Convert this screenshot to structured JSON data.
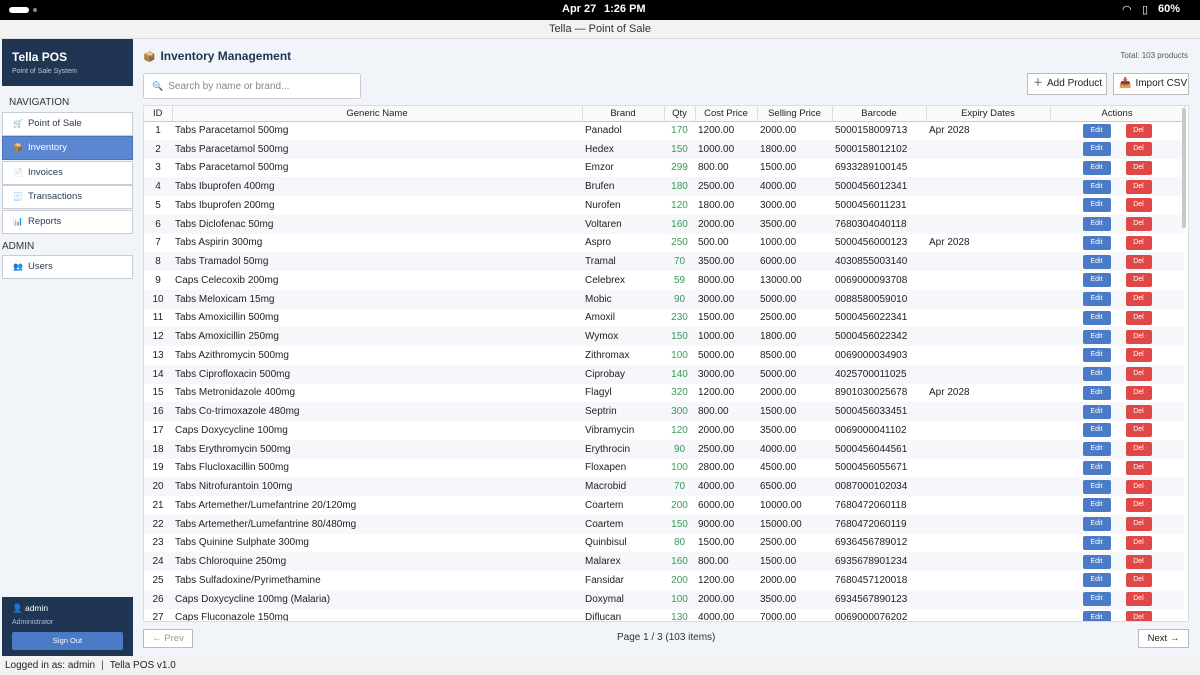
{
  "status_bar": {
    "date": "Apr 27",
    "time": "1:26 PM",
    "battery": "60%",
    "icons": [
      "wifi-icon",
      "do-not-disturb-icon",
      "battery-icon"
    ]
  },
  "window_title": "Tella — Point of Sale",
  "sidebar": {
    "brand_title": "Tella POS",
    "brand_subtitle": "Point of Sale System",
    "nav_header": "NAVIGATION",
    "nav_items": [
      {
        "label": "Point of Sale",
        "icon": "cart-icon",
        "glyph": "🛒"
      },
      {
        "label": "Inventory",
        "icon": "box-icon",
        "glyph": "📦",
        "active": true
      },
      {
        "label": "Invoices",
        "icon": "document-icon",
        "glyph": "📄"
      },
      {
        "label": "Transactions",
        "icon": "receipt-icon",
        "glyph": "🧾"
      },
      {
        "label": "Reports",
        "icon": "chart-icon",
        "glyph": "📊"
      }
    ],
    "admin_header": "ADMIN",
    "admin_items": [
      {
        "label": "Users",
        "icon": "users-icon",
        "glyph": "👥"
      }
    ],
    "user": {
      "name": "admin",
      "role": "Administrator",
      "sign_out": "Sign Out",
      "glyph": "👤"
    }
  },
  "main": {
    "title": "Inventory Management",
    "title_glyph": "📦",
    "total": "Total: 103 products",
    "search_placeholder": "Search by name or brand...",
    "add_product": "Add Product",
    "import_csv": "Import CSV",
    "columns": [
      "ID",
      "Generic Name",
      "Brand",
      "Qty",
      "Cost Price",
      "Selling Price",
      "Barcode",
      "Expiry Dates",
      "Actions"
    ],
    "edit_label": "Edit",
    "delete_label": "Del",
    "rows": [
      [
        "1",
        "Tabs Paracetamol 500mg",
        "Panadol",
        "170",
        "1200.00",
        "2000.00",
        "5000158009713",
        "Apr 2028"
      ],
      [
        "2",
        "Tabs Paracetamol 500mg",
        "Hedex",
        "150",
        "1000.00",
        "1800.00",
        "5000158012102",
        ""
      ],
      [
        "3",
        "Tabs Paracetamol 500mg",
        "Emzor",
        "299",
        "800.00",
        "1500.00",
        "6933289100145",
        ""
      ],
      [
        "4",
        "Tabs Ibuprofen 400mg",
        "Brufen",
        "180",
        "2500.00",
        "4000.00",
        "5000456012341",
        ""
      ],
      [
        "5",
        "Tabs Ibuprofen 200mg",
        "Nurofen",
        "120",
        "1800.00",
        "3000.00",
        "5000456011231",
        ""
      ],
      [
        "6",
        "Tabs Diclofenac 50mg",
        "Voltaren",
        "160",
        "2000.00",
        "3500.00",
        "7680304040118",
        ""
      ],
      [
        "7",
        "Tabs Aspirin 300mg",
        "Aspro",
        "250",
        "500.00",
        "1000.00",
        "5000456000123",
        "Apr 2028"
      ],
      [
        "8",
        "Tabs Tramadol 50mg",
        "Tramal",
        "70",
        "3500.00",
        "6000.00",
        "4030855003140",
        ""
      ],
      [
        "9",
        "Caps Celecoxib 200mg",
        "Celebrex",
        "59",
        "8000.00",
        "13000.00",
        "0069000093708",
        ""
      ],
      [
        "10",
        "Tabs Meloxicam 15mg",
        "Mobic",
        "90",
        "3000.00",
        "5000.00",
        "0088580059010",
        ""
      ],
      [
        "11",
        "Tabs Amoxicillin 500mg",
        "Amoxil",
        "230",
        "1500.00",
        "2500.00",
        "5000456022341",
        ""
      ],
      [
        "12",
        "Tabs Amoxicillin 250mg",
        "Wymox",
        "150",
        "1000.00",
        "1800.00",
        "5000456022342",
        ""
      ],
      [
        "13",
        "Tabs Azithromycin 500mg",
        "Zithromax",
        "100",
        "5000.00",
        "8500.00",
        "0069000034903",
        ""
      ],
      [
        "14",
        "Tabs Ciprofloxacin 500mg",
        "Ciprobay",
        "140",
        "3000.00",
        "5000.00",
        "4025700011025",
        ""
      ],
      [
        "15",
        "Tabs Metronidazole 400mg",
        "Flagyl",
        "320",
        "1200.00",
        "2000.00",
        "8901030025678",
        "Apr 2028"
      ],
      [
        "16",
        "Tabs Co-trimoxazole 480mg",
        "Septrin",
        "300",
        "800.00",
        "1500.00",
        "5000456033451",
        ""
      ],
      [
        "17",
        "Caps Doxycycline 100mg",
        "Vibramycin",
        "120",
        "2000.00",
        "3500.00",
        "0069000041102",
        ""
      ],
      [
        "18",
        "Tabs Erythromycin 500mg",
        "Erythrocin",
        "90",
        "2500.00",
        "4000.00",
        "5000456044561",
        ""
      ],
      [
        "19",
        "Tabs Flucloxacillin 500mg",
        "Floxapen",
        "100",
        "2800.00",
        "4500.00",
        "5000456055671",
        ""
      ],
      [
        "20",
        "Tabs Nitrofurantoin 100mg",
        "Macrobid",
        "70",
        "4000.00",
        "6500.00",
        "0087000102034",
        ""
      ],
      [
        "21",
        "Tabs Artemether/Lumefantrine 20/120mg",
        "Coartem",
        "200",
        "6000.00",
        "10000.00",
        "7680472060118",
        ""
      ],
      [
        "22",
        "Tabs Artemether/Lumefantrine 80/480mg",
        "Coartem",
        "150",
        "9000.00",
        "15000.00",
        "7680472060119",
        ""
      ],
      [
        "23",
        "Tabs Quinine Sulphate 300mg",
        "Quinbisul",
        "80",
        "1500.00",
        "2500.00",
        "6936456789012",
        ""
      ],
      [
        "24",
        "Tabs Chloroquine 250mg",
        "Malarex",
        "160",
        "800.00",
        "1500.00",
        "6935678901234",
        ""
      ],
      [
        "25",
        "Tabs Sulfadoxine/Pyrimethamine",
        "Fansidar",
        "200",
        "1200.00",
        "2000.00",
        "7680457120018",
        ""
      ],
      [
        "26",
        "Caps Doxycycline 100mg (Malaria)",
        "Doxymal",
        "100",
        "2000.00",
        "3500.00",
        "6934567890123",
        ""
      ],
      [
        "27",
        "Caps Fluconazole 150mg",
        "Diflucan",
        "130",
        "4000.00",
        "7000.00",
        "0069000076202",
        ""
      ]
    ],
    "pager": {
      "prev": "← Prev",
      "next": "Next →",
      "info": "Page 1 / 3  (103 items)"
    }
  },
  "footer": {
    "logged_in": "Logged in as: admin",
    "version": "Tella POS v1.0"
  }
}
